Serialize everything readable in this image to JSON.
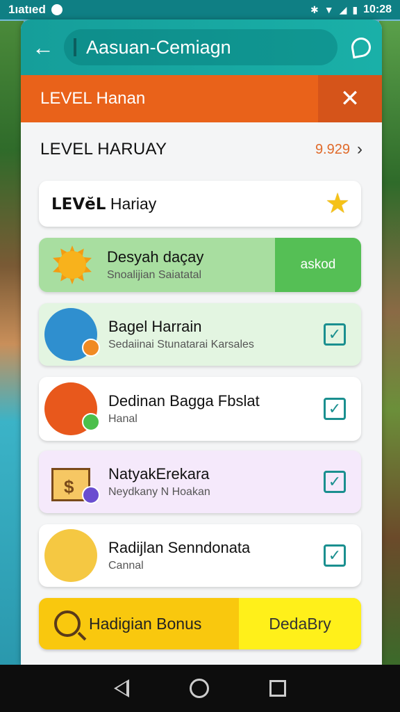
{
  "status_bar": {
    "carrier": "1ıatıed",
    "time": "10:28"
  },
  "app_bar": {
    "title": "Aasuan-Cemiagn"
  },
  "level_banner": {
    "label": "LEVEL Hanan"
  },
  "section": {
    "heading": "LEVEL HARUAY",
    "value": "9.929"
  },
  "level_card": {
    "label_bold": "LEVĕL",
    "label": "Hariay"
  },
  "daily_task": {
    "title": "Desyah daçay",
    "subtitle": "Snoalijian Saiatatal",
    "button": "askod"
  },
  "tasks": [
    {
      "title": "Bagel Harrain",
      "subtitle": "Sedaiinai Stunatarai Karsales",
      "bg": "#e3f5e1",
      "avatar_color": "#2f8fcf",
      "badge_color": "#f08a24"
    },
    {
      "title": "Dedinan Bagga Fbslat",
      "subtitle": "Hanal",
      "bg": "#ffffff",
      "avatar_color": "#e8581c",
      "badge_color": "#4bbf4b"
    },
    {
      "title": "NatyakErekara",
      "subtitle": "Neydkany N Hoakan",
      "bg": "#f5e9fb",
      "avatar_color": "#ffffff",
      "badge_color": "#6a4ed0"
    },
    {
      "title": "Radijlan Senndonata",
      "subtitle": "Cannal",
      "bg": "#ffffff",
      "avatar_color": "#f5c842",
      "badge_color": "#ffffff"
    }
  ],
  "bonus_bar": {
    "label": "Hadigian Bonus",
    "button": "DedaBry"
  },
  "icons": [
    "back-arrow-icon",
    "leaf-icon",
    "close-icon",
    "chevron-right-icon",
    "star-icon",
    "sun-icon",
    "check-icon",
    "search-icon",
    "nav-back-icon",
    "nav-home-icon",
    "nav-recent-icon"
  ],
  "colors": {
    "teal": "#159e9a",
    "orange": "#e9621a",
    "green": "#55bf55",
    "yellow": "#f9c80e",
    "accent_number": "#e06a2a"
  }
}
